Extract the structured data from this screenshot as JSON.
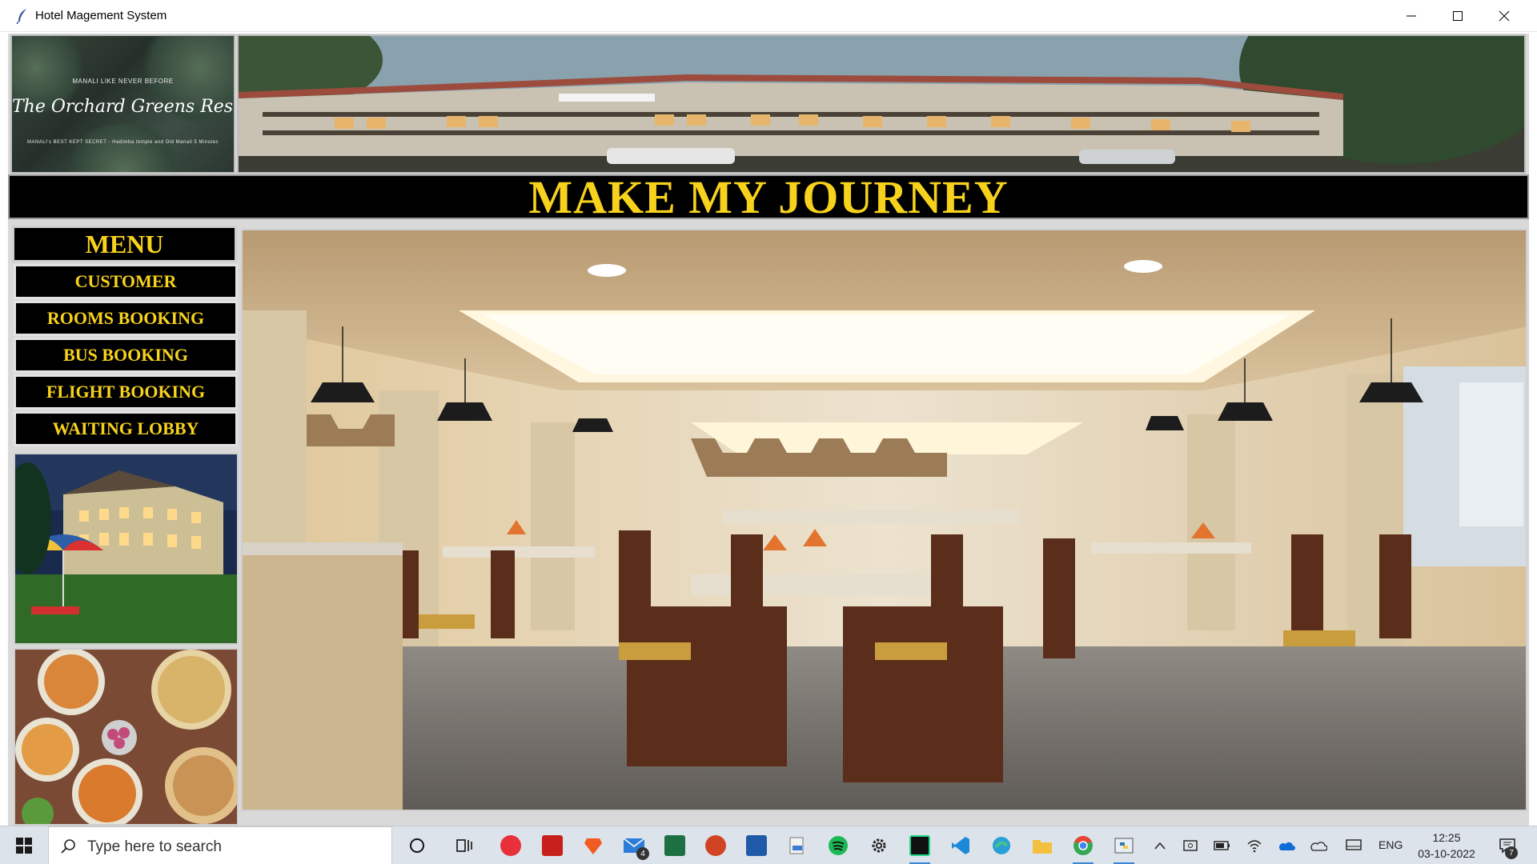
{
  "window": {
    "title": "Hotel Magement System"
  },
  "logo": {
    "tagline": "MANALI LIKE NEVER BEFORE",
    "name": "The Orchard Greens Resort & Spa",
    "subtag": "MANALI's BEST KEPT SECRET - Hadimba temple and Old Manali 5 Minutes"
  },
  "header": {
    "title": "MAKE MY JOURNEY"
  },
  "menu": {
    "heading": "MENU",
    "items": [
      {
        "label": "CUSTOMER"
      },
      {
        "label": "ROOMS BOOKING"
      },
      {
        "label": "BUS BOOKING"
      },
      {
        "label": "FLIGHT BOOKING"
      },
      {
        "label": "WAITING LOBBY"
      }
    ]
  },
  "taskbar": {
    "search_placeholder": "Type here to search",
    "mail_badge": "4",
    "language": "ENG",
    "time": "12:25",
    "date": "03-10-2022",
    "notification_count": "7",
    "icons": [
      "windows-start-icon",
      "search-icon",
      "cortana-icon",
      "task-view-icon",
      "ea-icon",
      "acrobat-icon",
      "brave-icon",
      "mail-icon",
      "excel-icon",
      "powerpoint-icon",
      "word-icon",
      "paint-icon",
      "spotify-icon",
      "settings-icon",
      "pycharm-icon",
      "vscode-icon",
      "edge-icon",
      "file-explorer-icon",
      "chrome-icon",
      "python-icon"
    ]
  },
  "colors": {
    "accent_yellow": "#f7d21c",
    "panel_black": "#000000",
    "taskbar_bg": "#dde3ea"
  }
}
